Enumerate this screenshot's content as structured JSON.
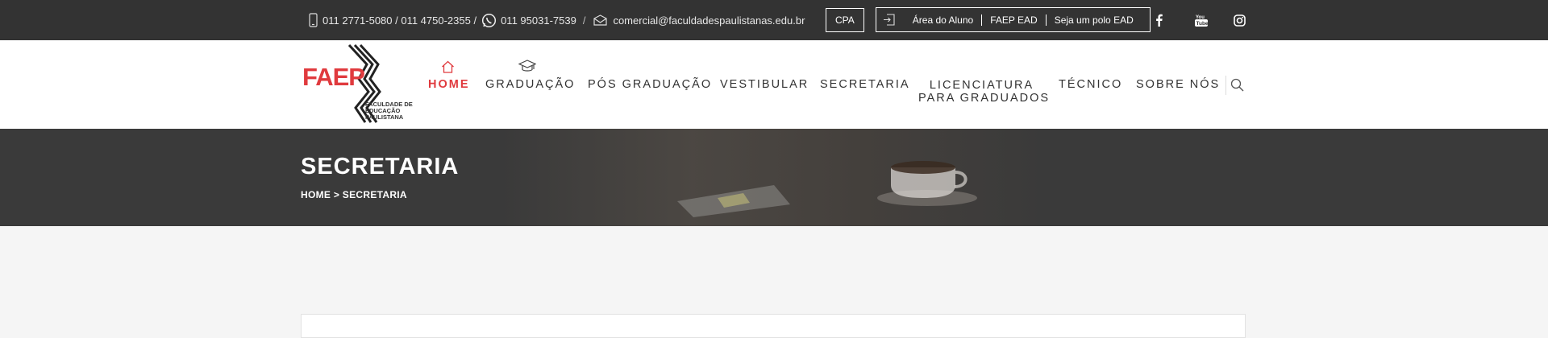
{
  "topbar": {
    "phones": "011 2771-5080 / 011 4750-2355 /",
    "whatsapp": "011 95031-7539",
    "slash": "/",
    "email": "comercial@faculdadespaulistanas.edu.br",
    "cpa": "CPA",
    "links": [
      "Área do Aluno",
      "FAEP EAD",
      "Seja um polo EAD"
    ],
    "social": [
      "facebook-icon",
      "youtube-icon",
      "instagram-icon"
    ]
  },
  "logo": {
    "text": "FAEP",
    "subtitle": "FACULDADE DE EDUCAÇÃO PAULISTANA"
  },
  "nav": {
    "items": [
      {
        "label": "HOME",
        "active": true
      },
      {
        "label": "GRADUAÇÃO"
      },
      {
        "label": "PÓS GRADUAÇÃO"
      },
      {
        "label": "VESTIBULAR"
      },
      {
        "label": "SECRETARIA"
      },
      {
        "label": "LICENCIATURA"
      },
      {
        "label": "PARA GRADUADOS"
      },
      {
        "label": "TÉCNICO"
      },
      {
        "label": "SOBRE NÓS"
      }
    ],
    "accent": "#e03a3e"
  },
  "hero": {
    "title": "SECRETARIA",
    "breadcrumb": "HOME > SECRETARIA"
  }
}
